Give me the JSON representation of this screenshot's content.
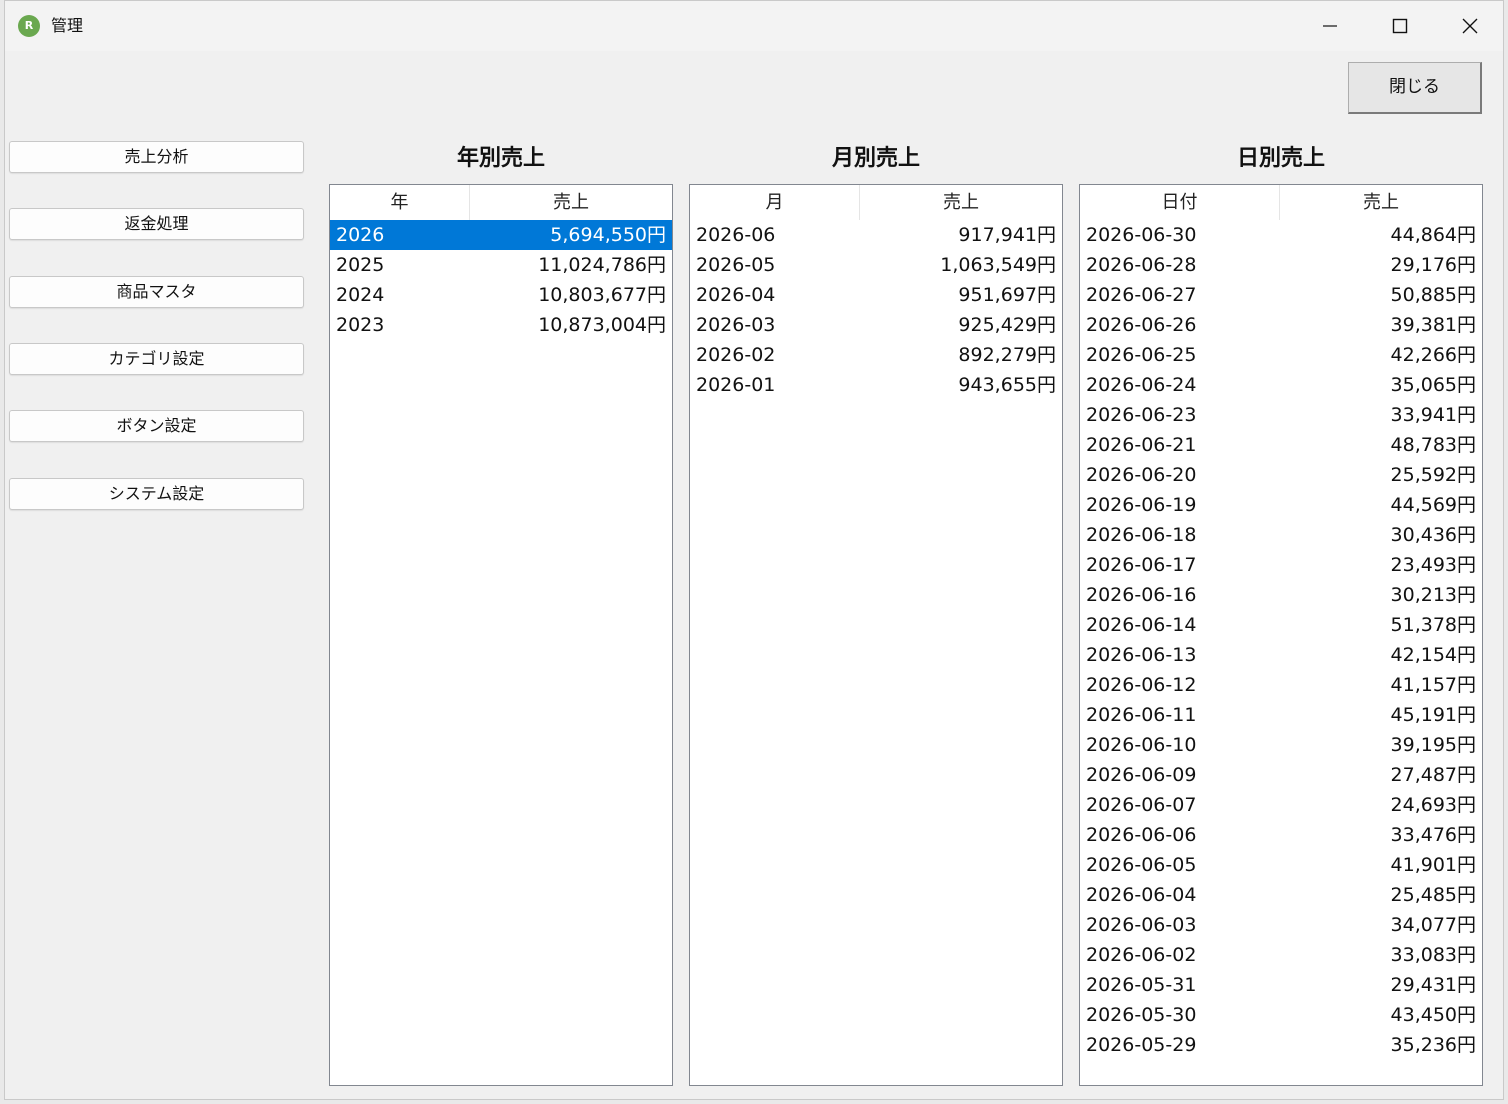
{
  "window": {
    "title": "管理",
    "icon_text": "R",
    "close_button_label": "閉じる"
  },
  "nav": [
    {
      "label": "売上分析"
    },
    {
      "label": "返金処理"
    },
    {
      "label": "商品マスタ"
    },
    {
      "label": "カテゴリ設定"
    },
    {
      "label": "ボタン設定"
    },
    {
      "label": "システム設定"
    }
  ],
  "yearly": {
    "title": "年別売上",
    "col1": "年",
    "col2": "売上",
    "selected_index": 0,
    "rows": [
      {
        "key": "2026",
        "value": "5,694,550円"
      },
      {
        "key": "2025",
        "value": "11,024,786円"
      },
      {
        "key": "2024",
        "value": "10,803,677円"
      },
      {
        "key": "2023",
        "value": "10,873,004円"
      }
    ]
  },
  "monthly": {
    "title": "月別売上",
    "col1": "月",
    "col2": "売上",
    "rows": [
      {
        "key": "2026-06",
        "value": "917,941円"
      },
      {
        "key": "2026-05",
        "value": "1,063,549円"
      },
      {
        "key": "2026-04",
        "value": "951,697円"
      },
      {
        "key": "2026-03",
        "value": "925,429円"
      },
      {
        "key": "2026-02",
        "value": "892,279円"
      },
      {
        "key": "2026-01",
        "value": "943,655円"
      }
    ]
  },
  "daily": {
    "title": "日別売上",
    "col1": "日付",
    "col2": "売上",
    "rows": [
      {
        "key": "2026-06-30",
        "value": "44,864円"
      },
      {
        "key": "2026-06-28",
        "value": "29,176円"
      },
      {
        "key": "2026-06-27",
        "value": "50,885円"
      },
      {
        "key": "2026-06-26",
        "value": "39,381円"
      },
      {
        "key": "2026-06-25",
        "value": "42,266円"
      },
      {
        "key": "2026-06-24",
        "value": "35,065円"
      },
      {
        "key": "2026-06-23",
        "value": "33,941円"
      },
      {
        "key": "2026-06-21",
        "value": "48,783円"
      },
      {
        "key": "2026-06-20",
        "value": "25,592円"
      },
      {
        "key": "2026-06-19",
        "value": "44,569円"
      },
      {
        "key": "2026-06-18",
        "value": "30,436円"
      },
      {
        "key": "2026-06-17",
        "value": "23,493円"
      },
      {
        "key": "2026-06-16",
        "value": "30,213円"
      },
      {
        "key": "2026-06-14",
        "value": "51,378円"
      },
      {
        "key": "2026-06-13",
        "value": "42,154円"
      },
      {
        "key": "2026-06-12",
        "value": "41,157円"
      },
      {
        "key": "2026-06-11",
        "value": "45,191円"
      },
      {
        "key": "2026-06-10",
        "value": "39,195円"
      },
      {
        "key": "2026-06-09",
        "value": "27,487円"
      },
      {
        "key": "2026-06-07",
        "value": "24,693円"
      },
      {
        "key": "2026-06-06",
        "value": "33,476円"
      },
      {
        "key": "2026-06-05",
        "value": "41,901円"
      },
      {
        "key": "2026-06-04",
        "value": "25,485円"
      },
      {
        "key": "2026-06-03",
        "value": "34,077円"
      },
      {
        "key": "2026-06-02",
        "value": "33,083円"
      },
      {
        "key": "2026-05-31",
        "value": "29,431円"
      },
      {
        "key": "2026-05-30",
        "value": "43,450円"
      },
      {
        "key": "2026-05-29",
        "value": "35,236円"
      }
    ]
  },
  "colors": {
    "selection": "#0078d7",
    "app_icon": "#6aa84f"
  }
}
